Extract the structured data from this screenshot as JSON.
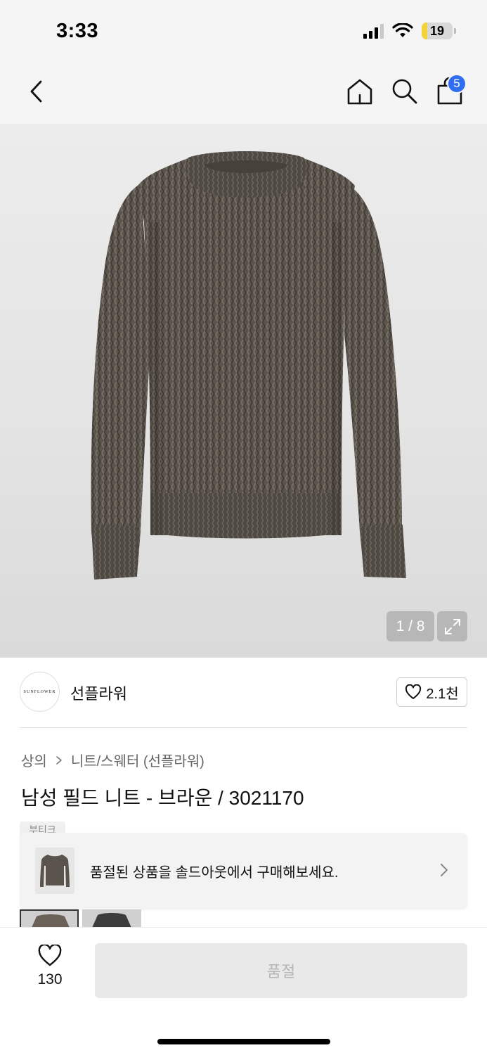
{
  "status_bar": {
    "time": "3:33",
    "battery_level": "19",
    "battery_fraction": 0.19,
    "battery_color": "#f4d23a",
    "signal_bars_active": 3,
    "signal_bars_total": 4
  },
  "nav": {
    "back_icon": "chevron-left-icon",
    "home_icon": "home-icon",
    "search_icon": "search-icon",
    "cart_icon": "shopping-bag-icon",
    "cart_badge": "5",
    "badge_color": "#2f6ef0"
  },
  "gallery": {
    "page_indicator": "1 / 8",
    "expand_icon": "expand-icon"
  },
  "brand": {
    "logo_text": "SUNFLOWER",
    "name": "선플라워",
    "like_count": "2.1천",
    "like_icon": "heart-outline-icon"
  },
  "breadcrumb": {
    "items": [
      "상의",
      "니트/스웨터 (선플라워)"
    ]
  },
  "product": {
    "title": "남성 필드 니트 - 브라운 / 3021170",
    "tag_peek": "부티크"
  },
  "soldout_banner": {
    "text": "품절된 상품을 솔드아웃에서 구매해보세요."
  },
  "bottom_bar": {
    "wish_count": "130",
    "buy_label": "품절"
  }
}
